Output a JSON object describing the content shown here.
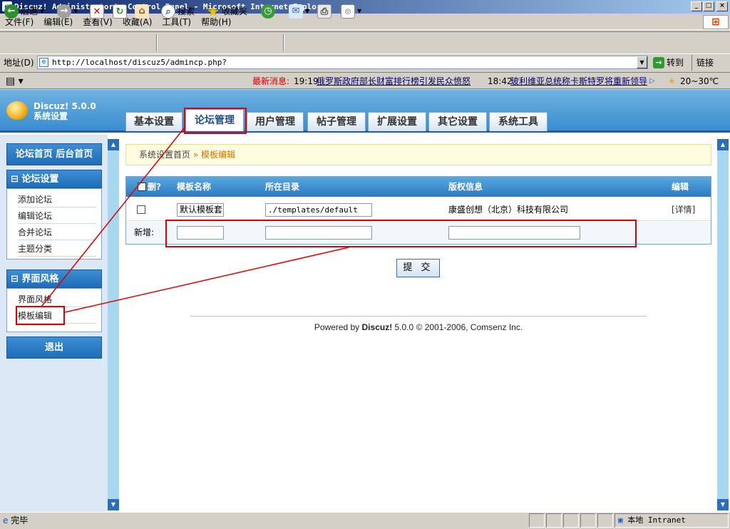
{
  "window": {
    "title": "Discuz! Administrator's Control Panel - Microsoft Internet Explorer",
    "min": "_",
    "max": "□",
    "close": "×"
  },
  "menu": [
    "文件(F)",
    "编辑(E)",
    "查看(V)",
    "收藏(A)",
    "工具(T)",
    "帮助(H)"
  ],
  "toolbar": {
    "back": "后退",
    "search": "搜索",
    "favorites": "收藏夹"
  },
  "address": {
    "label": "地址(D)",
    "url": "http://localhost/discuz5/admincp.php?",
    "go": "转到",
    "links": "链接"
  },
  "news": {
    "label": "最新消息:",
    "item1_time": "19:19",
    "item1_text": "俄罗斯政府部长财富排行榜引发民众愤怒",
    "item2_time": "18:42",
    "item2_text": "玻利维亚总统称卡斯特罗将重新领导",
    "weather": "20~30℃"
  },
  "logo": {
    "name": "Discuz! 5.0.0",
    "sub": "系统设置"
  },
  "tabs": [
    "基本设置",
    "论坛管理",
    "用户管理",
    "帖子管理",
    "扩展设置",
    "其它设置",
    "系统工具"
  ],
  "sidebar": {
    "home": "论坛首页  后台首页",
    "forum_title": "⊟ 论坛设置",
    "forum_items": [
      "添加论坛",
      "编辑论坛",
      "合并论坛",
      "主题分类"
    ],
    "style_title": "⊟ 界面风格",
    "style_items": [
      "界面风格",
      "模板编辑"
    ],
    "logout": "退出"
  },
  "breadcrumb": {
    "home": "系统设置首页",
    "sep": " » ",
    "current": "模板编辑"
  },
  "table": {
    "headers": {
      "del": "删?",
      "name": "模板名称",
      "dir": "所在目录",
      "copyright": "版权信息",
      "edit": "编辑"
    },
    "row": {
      "name": "默认模板套",
      "dir": "./templates/default",
      "copyright": "康盛创想（北京）科技有限公司",
      "edit": "[详情]"
    },
    "new_label": "新增:"
  },
  "submit": "提 交",
  "footer": {
    "pre": "Powered by ",
    "brand": "Discuz!",
    "ver": " 5.0.0",
    "rest": "  © 2001-2006, Comsenz Inc."
  },
  "status": {
    "done": "完毕",
    "zone": "本地 Intranet"
  },
  "colors": {
    "annotation": "#e00000",
    "accent": "#2a7ac4"
  }
}
